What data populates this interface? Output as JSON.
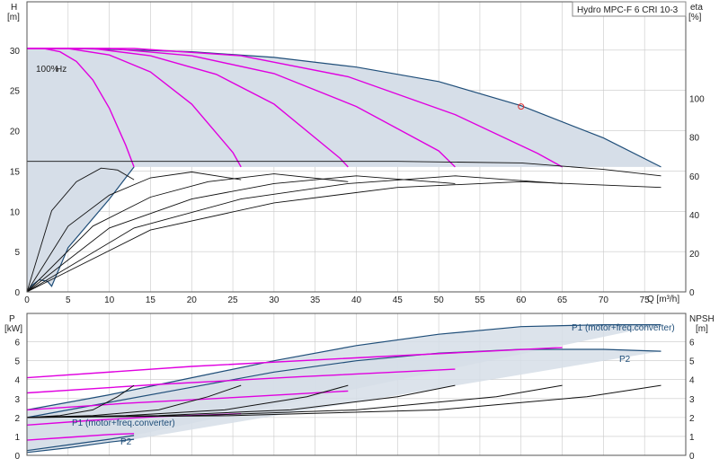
{
  "chart_data": [
    {
      "type": "line",
      "title": "Hydro MPC-F 6 CRI 10-3",
      "xlabel": "Q [m³/h]",
      "ylabel_left": "H",
      "ylabel_left_unit": "[m]",
      "ylabel_right": "eta",
      "ylabel_right_unit": "[%]",
      "xlim": [
        0,
        80
      ],
      "ylim_left": [
        0,
        36
      ],
      "ylim_right": [
        0,
        150
      ],
      "x_ticks": [
        0,
        5,
        10,
        15,
        20,
        25,
        30,
        35,
        40,
        45,
        50,
        55,
        60,
        65,
        70,
        75
      ],
      "y_ticks_left": [
        0,
        5,
        10,
        15,
        20,
        25,
        30
      ],
      "y_ticks_right": [
        0,
        20,
        40,
        60,
        80,
        100
      ],
      "grid": true,
      "annotations": [
        "100%",
        "Hz"
      ],
      "operating_point": {
        "x": 60,
        "y": 23
      },
      "series": [
        {
          "role": "envelope-max",
          "color": "#1f4e79",
          "x": [
            0,
            5,
            10,
            20,
            30,
            40,
            50,
            60,
            70,
            77
          ],
          "y": [
            30.2,
            30.2,
            30.1,
            29.8,
            29.1,
            27.9,
            26.1,
            23.1,
            19.1,
            15.5
          ]
        },
        {
          "role": "envelope-min",
          "color": "#1f4e79",
          "x": [
            0,
            0.6,
            1.5,
            2.5,
            3,
            5,
            10,
            13
          ],
          "y": [
            0,
            0.8,
            1.5,
            1.3,
            0.7,
            5.5,
            11.5,
            15.5
          ]
        },
        {
          "role": "pump-curve",
          "pumps": 1,
          "color": "#e000e0",
          "x": [
            0,
            2,
            4,
            6,
            8,
            10,
            12,
            13
          ],
          "y": [
            30.2,
            30.2,
            29.8,
            28.6,
            26.3,
            22.8,
            18.2,
            15.5
          ]
        },
        {
          "role": "pump-curve",
          "pumps": 2,
          "color": "#e000e0",
          "x": [
            0,
            5,
            10,
            15,
            20,
            25,
            26
          ],
          "y": [
            30.2,
            30.2,
            29.4,
            27.3,
            23.3,
            17.3,
            15.5
          ]
        },
        {
          "role": "pump-curve",
          "pumps": 3,
          "color": "#e000e0",
          "x": [
            0,
            8,
            15,
            23,
            30,
            38,
            39
          ],
          "y": [
            30.2,
            30.2,
            29.3,
            27.0,
            23.3,
            16.6,
            15.5
          ]
        },
        {
          "role": "pump-curve",
          "pumps": 4,
          "color": "#e000e0",
          "x": [
            0,
            10,
            20,
            30,
            40,
            50,
            52
          ],
          "y": [
            30.2,
            30.2,
            29.3,
            27.1,
            23.0,
            17.5,
            15.5
          ]
        },
        {
          "role": "pump-curve",
          "pumps": 5,
          "color": "#e000e0",
          "x": [
            0,
            13,
            26,
            39,
            52,
            62,
            65
          ],
          "y": [
            30.2,
            30.2,
            29.3,
            26.7,
            22.0,
            17.2,
            15.5
          ]
        },
        {
          "role": "eta-curve",
          "pumps": 1,
          "color": "#111111",
          "x": [
            0,
            3,
            6,
            9,
            11,
            13
          ],
          "y_eta": [
            0,
            42,
            57,
            64,
            63,
            58
          ]
        },
        {
          "role": "eta-curve",
          "pumps": 2,
          "color": "#111111",
          "x": [
            0,
            5,
            10,
            15,
            20,
            26
          ],
          "y_eta": [
            0,
            34,
            50,
            59,
            62,
            58
          ]
        },
        {
          "role": "eta-curve",
          "pumps": 3,
          "color": "#111111",
          "x": [
            0,
            8,
            15,
            22,
            30,
            39
          ],
          "y_eta": [
            0,
            34,
            49,
            57,
            61,
            57
          ]
        },
        {
          "role": "eta-curve",
          "pumps": 4,
          "color": "#111111",
          "x": [
            0,
            10,
            20,
            30,
            40,
            52
          ],
          "y_eta": [
            0,
            33,
            48,
            56,
            60,
            56
          ]
        },
        {
          "role": "eta-curve",
          "pumps": 5,
          "color": "#111111",
          "x": [
            0,
            13,
            26,
            39,
            52,
            65
          ],
          "y_eta": [
            0,
            33,
            48,
            56,
            60,
            56
          ]
        },
        {
          "role": "eta-curve",
          "pumps": 6,
          "color": "#111111",
          "x": [
            0,
            15,
            30,
            45,
            60,
            77
          ],
          "y_eta": [
            0,
            32,
            46,
            54,
            57,
            54
          ]
        },
        {
          "role": "h-upper-curve",
          "color": "#111111",
          "x": [
            0,
            15,
            30,
            45,
            60,
            70,
            77
          ],
          "y": [
            16.2,
            16.2,
            16.2,
            16.2,
            16.0,
            15.2,
            14.4
          ]
        }
      ]
    },
    {
      "type": "line",
      "xlim": [
        0,
        80
      ],
      "ylabel_left": "P",
      "ylabel_left_unit": "[kW]",
      "ylabel_right": "NPSH",
      "ylabel_right_unit": "[m]",
      "ylim_left": [
        0,
        7.5
      ],
      "ylim_right": [
        0,
        7.5
      ],
      "y_ticks_left": [
        0,
        1,
        2,
        3,
        4,
        5,
        6
      ],
      "y_ticks_right": [
        0,
        1,
        2,
        3,
        4,
        5,
        6
      ],
      "grid": true,
      "labels": {
        "p1_top": "P1 (motor+freq.converter)",
        "p2_top": "P2",
        "p1_bottom": "P1 (motor+freq.converter)",
        "p2_bottom": "P2"
      },
      "series": [
        {
          "role": "P1-max",
          "color": "#1f4e79",
          "x": [
            0,
            10,
            20,
            30,
            40,
            50,
            60,
            70,
            77
          ],
          "y": [
            2.4,
            3.2,
            4.1,
            5.0,
            5.8,
            6.4,
            6.8,
            6.9,
            6.9
          ]
        },
        {
          "role": "P2-max",
          "color": "#1f4e79",
          "x": [
            0,
            10,
            20,
            30,
            40,
            50,
            60,
            70,
            77
          ],
          "y": [
            2.0,
            2.8,
            3.6,
            4.4,
            5.0,
            5.4,
            5.6,
            5.6,
            5.5
          ]
        },
        {
          "role": "P1-min",
          "color": "#1f4e79",
          "x": [
            0,
            5,
            10,
            13
          ],
          "y": [
            0.25,
            0.55,
            0.85,
            1.05
          ]
        },
        {
          "role": "P2-min",
          "color": "#1f4e79",
          "x": [
            0,
            5,
            10,
            13
          ],
          "y": [
            0.15,
            0.4,
            0.7,
            0.85
          ]
        },
        {
          "role": "power-curve",
          "pumps": 1,
          "color": "#e000e0",
          "x": [
            0,
            5,
            10,
            13
          ],
          "y": [
            0.8,
            0.95,
            1.1,
            1.15
          ]
        },
        {
          "role": "power-curve",
          "pumps": 2,
          "color": "#e000e0",
          "x": [
            0,
            8,
            16,
            26
          ],
          "y": [
            1.6,
            1.85,
            2.05,
            2.2
          ]
        },
        {
          "role": "power-curve",
          "pumps": 3,
          "color": "#e000e0",
          "x": [
            0,
            12,
            25,
            39
          ],
          "y": [
            2.4,
            2.75,
            3.05,
            3.4
          ]
        },
        {
          "role": "power-curve",
          "pumps": 4,
          "color": "#e000e0",
          "x": [
            0,
            16,
            33,
            52
          ],
          "y": [
            3.3,
            3.75,
            4.15,
            4.55
          ]
        },
        {
          "role": "power-curve",
          "pumps": 5,
          "color": "#e000e0",
          "x": [
            0,
            20,
            42,
            65
          ],
          "y": [
            4.1,
            4.7,
            5.2,
            5.7
          ]
        },
        {
          "role": "npsh-curve",
          "pumps": 1,
          "color": "#111111",
          "x": [
            0,
            4,
            8,
            11,
            13
          ],
          "y": [
            2.0,
            2.1,
            2.4,
            3.1,
            3.7
          ]
        },
        {
          "role": "npsh-curve",
          "pumps": 2,
          "color": "#111111",
          "x": [
            0,
            8,
            16,
            22,
            26
          ],
          "y": [
            2.0,
            2.1,
            2.4,
            3.1,
            3.7
          ]
        },
        {
          "role": "npsh-curve",
          "pumps": 3,
          "color": "#111111",
          "x": [
            0,
            12,
            24,
            34,
            39
          ],
          "y": [
            2.0,
            2.1,
            2.4,
            3.1,
            3.7
          ]
        },
        {
          "role": "npsh-curve",
          "pumps": 4,
          "color": "#111111",
          "x": [
            0,
            16,
            32,
            45,
            52
          ],
          "y": [
            2.0,
            2.1,
            2.4,
            3.1,
            3.7
          ]
        },
        {
          "role": "npsh-curve",
          "pumps": 5,
          "color": "#111111",
          "x": [
            0,
            20,
            40,
            57,
            65
          ],
          "y": [
            2.0,
            2.1,
            2.4,
            3.1,
            3.7
          ]
        },
        {
          "role": "npsh-curve",
          "pumps": 6,
          "color": "#111111",
          "x": [
            0,
            25,
            50,
            68,
            77
          ],
          "y": [
            2.0,
            2.1,
            2.4,
            3.1,
            3.7
          ]
        }
      ]
    }
  ],
  "colors": {
    "envelope_fill": "#d6dee8",
    "envelope_line": "#1f4e79",
    "pump_curve": "#e000e0",
    "eta_curve": "#111111",
    "grid": "#c8c8c8",
    "operating_point": "#e03030"
  }
}
